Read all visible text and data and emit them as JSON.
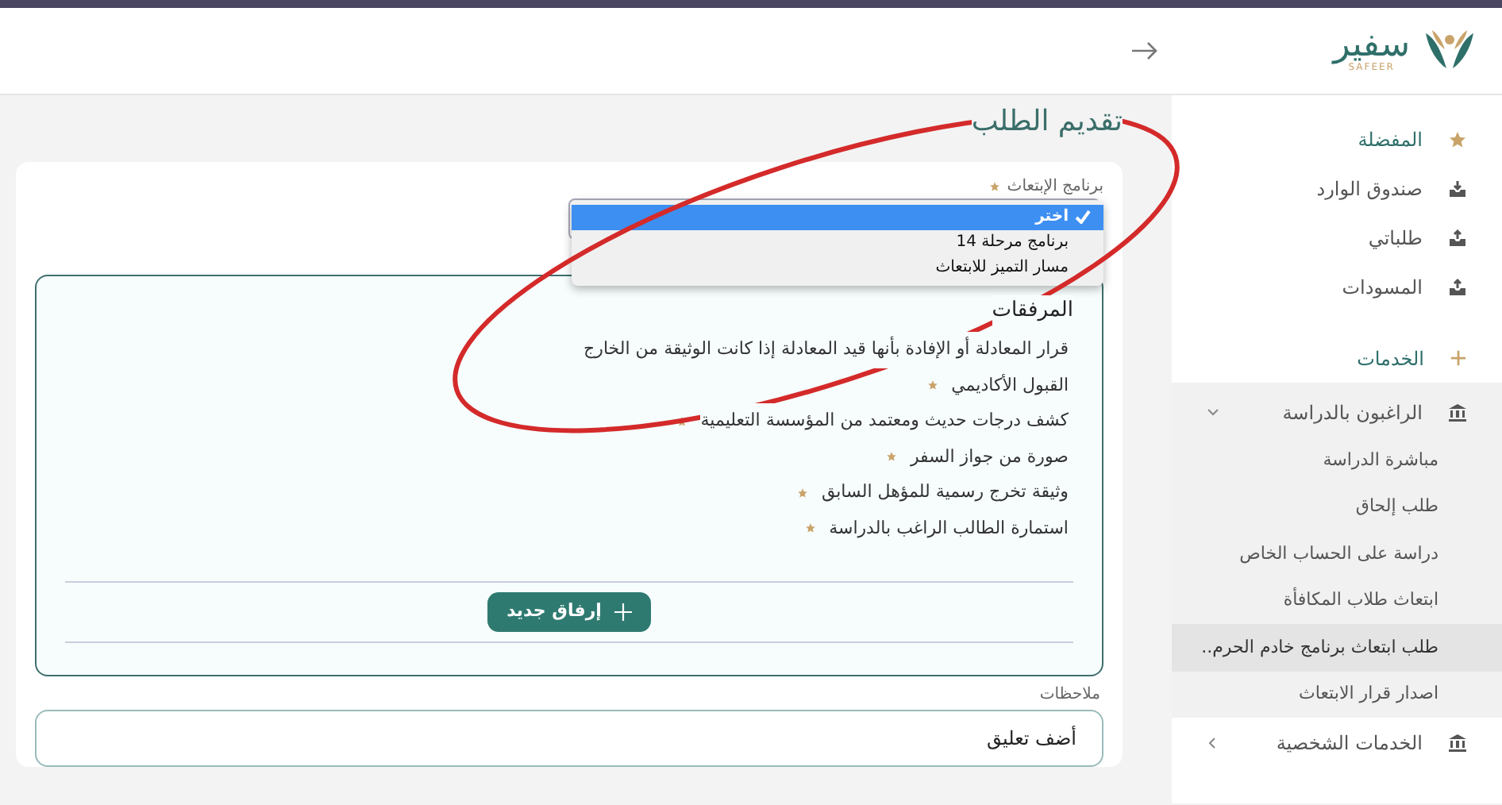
{
  "header": {
    "logo_text": "سفير",
    "logo_subtext": "SAFEER"
  },
  "sidebar": {
    "items": [
      {
        "kind": "starred",
        "label": "المفضلة"
      },
      {
        "kind": "incoming",
        "label": "صندوق الوارد"
      },
      {
        "kind": "outgoing",
        "label": "طلباتي"
      },
      {
        "kind": "outgoing",
        "label": "المسودات"
      },
      {
        "kind": "section",
        "label": "الخدمات"
      },
      {
        "kind": "group",
        "label": "الراغبون بالدراسة",
        "expanded": true,
        "children": [
          {
            "label": "مباشرة الدراسة",
            "selected": false
          },
          {
            "label": "طلب إلحاق",
            "selected": false
          },
          {
            "label": "دراسة على الحساب الخاص",
            "selected": false
          },
          {
            "label": "ابتعاث طلاب المكافأة",
            "selected": false
          },
          {
            "label": "طلب ابتعاث برنامج خادم الحرم..",
            "selected": true
          },
          {
            "label": "اصدار قرار الابتعاث",
            "selected": false
          }
        ]
      },
      {
        "kind": "group",
        "label": "الخدمات الشخصية",
        "expanded": false
      }
    ]
  },
  "page_title": "تقديم الطلب",
  "program_field": {
    "label": "برنامج الإبتعاث",
    "required": true,
    "expanded": true,
    "options": [
      {
        "label": "اختر",
        "selected": true
      },
      {
        "label": "برنامج مرحلة 14",
        "selected": false
      },
      {
        "label": "مسار التميز للابتعاث",
        "selected": false
      }
    ]
  },
  "attachments": {
    "title": "المرفقات",
    "items": [
      {
        "text": "قرار المعادلة أو الإفادة بأنها قيد المعادلة إذا كانت الوثيقة من الخارج",
        "required": false
      },
      {
        "text": "القبول الأكاديمي",
        "required": true
      },
      {
        "text": "كشف درجات حديث ومعتمد من المؤسسة التعليمية",
        "required": true
      },
      {
        "text": "صورة من جواز السفر",
        "required": true
      },
      {
        "text": "وثيقة تخرج رسمية للمؤهل السابق",
        "required": true
      },
      {
        "text": "استمارة الطالب الراغب بالدراسة",
        "required": true
      }
    ],
    "add_button": "إرفاق جديد"
  },
  "notes": {
    "label": "ملاحظات",
    "placeholder": "أضف تعليق"
  },
  "annotation": {
    "kind": "ellipse"
  }
}
